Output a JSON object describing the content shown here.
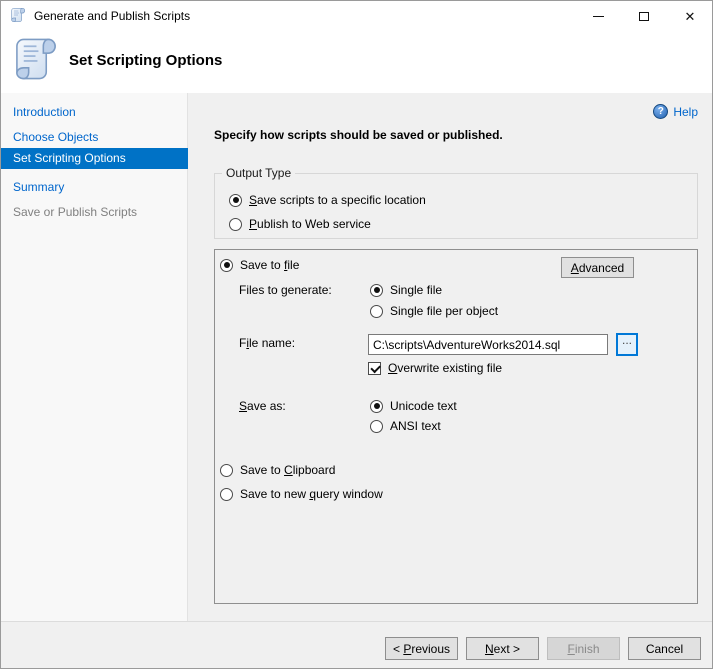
{
  "window": {
    "title": "Generate and Publish Scripts",
    "controls": {
      "close_glyph": "✕"
    }
  },
  "header": {
    "title": "Set Scripting Options"
  },
  "sidebar": {
    "items": [
      {
        "label": "Introduction",
        "state": "link"
      },
      {
        "label": "Choose Objects",
        "state": "link"
      },
      {
        "label": "Set Scripting Options",
        "state": "selected"
      },
      {
        "label": "Summary",
        "state": "link"
      },
      {
        "label": "Save or Publish Scripts",
        "state": "disabled"
      }
    ]
  },
  "main": {
    "help": {
      "label": "Help",
      "icon_glyph": "?"
    },
    "heading": "Specify how scripts should be saved or published.",
    "output_type": {
      "legend": "Output Type",
      "save_location": {
        "pre": "",
        "key": "S",
        "post": "ave scripts to a specific location",
        "selected": true
      },
      "publish_web": {
        "pre": "",
        "key": "P",
        "post": "ublish to Web service",
        "selected": false
      }
    },
    "save_panel": {
      "save_to_file": {
        "pre": "Save to ",
        "key": "f",
        "post": "ile",
        "selected": true
      },
      "advanced_button": {
        "pre": "",
        "key": "A",
        "post": "dvanced"
      },
      "files_to_generate_label": "Files to generate:",
      "single_file": {
        "label": "Single file",
        "selected": true
      },
      "single_file_per_object": {
        "label": "Single file per object",
        "selected": false
      },
      "file_name_label": {
        "pre": "F",
        "key": "i",
        "post": "le name:"
      },
      "file_name_value": "C:\\scripts\\AdventureWorks2014.sql",
      "browse_button_label": "...",
      "overwrite_checkbox": {
        "pre": "",
        "key": "O",
        "post": "verwrite existing file",
        "checked": true
      },
      "save_as_label": {
        "pre": "",
        "key": "S",
        "post": "ave as:"
      },
      "unicode_text": {
        "label": "Unicode text",
        "selected": true
      },
      "ansi_text": {
        "label": "ANSI text",
        "selected": false
      },
      "save_to_clipboard": {
        "pre": "Save to ",
        "key": "C",
        "post": "lipboard",
        "selected": false
      },
      "save_to_query_window": {
        "pre": "Save to new ",
        "key": "q",
        "post": "uery window",
        "selected": false
      }
    },
    "footer_buttons": {
      "previous": {
        "pre": "< ",
        "key": "P",
        "post": "revious",
        "enabled": true
      },
      "next": {
        "pre": "",
        "key": "N",
        "post": "ext >",
        "enabled": true
      },
      "finish": {
        "pre": "",
        "key": "F",
        "post": "inish",
        "enabled": false
      },
      "cancel": {
        "pre": "Cancel",
        "key": "",
        "post": "",
        "enabled": true
      }
    }
  },
  "colors": {
    "nav_selected_bg": "#0072C6",
    "link_blue": "#0066CC",
    "focus_blue": "#0078D7",
    "content_bg": "#F0F0F0",
    "header_bg": "#FFFFFF"
  }
}
